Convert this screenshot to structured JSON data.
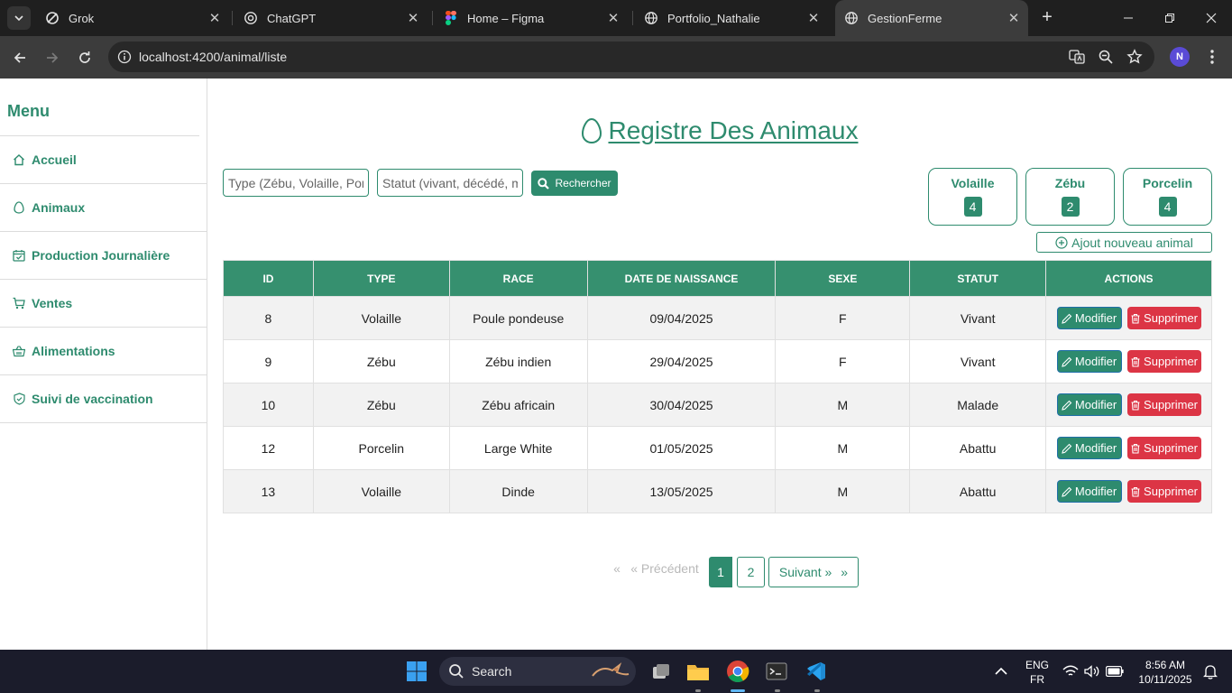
{
  "browser": {
    "tabs": [
      {
        "title": "Grok",
        "icon": "grok-icon",
        "active": false
      },
      {
        "title": "ChatGPT",
        "icon": "chatgpt-icon",
        "active": false
      },
      {
        "title": "Home – Figma",
        "icon": "figma-icon",
        "active": false
      },
      {
        "title": "Portfolio_Nathalie",
        "icon": "globe-icon",
        "active": false
      },
      {
        "title": "GestionFerme",
        "icon": "globe-icon",
        "active": true
      }
    ],
    "url": "localhost:4200/animal/liste",
    "profile_initial": "N"
  },
  "sidebar": {
    "title": "Menu",
    "items": [
      {
        "label": "Accueil",
        "icon": "home-icon"
      },
      {
        "label": "Animaux",
        "icon": "egg-icon"
      },
      {
        "label": "Production Journalière",
        "icon": "calendar-check-icon"
      },
      {
        "label": "Ventes",
        "icon": "cart-icon"
      },
      {
        "label": "Alimentations",
        "icon": "basket-icon"
      },
      {
        "label": "Suivi de vaccination",
        "icon": "shield-check-icon"
      }
    ]
  },
  "main": {
    "title": "Registre Des Animaux",
    "search": {
      "type_placeholder": "Type (Zébu, Volaille, Porcelin)",
      "status_placeholder": "Statut (vivant, décédé, malade)",
      "button_label": "Rechercher"
    },
    "stats": [
      {
        "label": "Volaille",
        "count": "4"
      },
      {
        "label": "Zébu",
        "count": "2"
      },
      {
        "label": "Porcelin",
        "count": "4"
      }
    ],
    "add_button": "Ajout nouveau animal",
    "table": {
      "columns": [
        "ID",
        "Type",
        "Race",
        "Date de naissance",
        "Sexe",
        "Statut",
        "Actions"
      ],
      "rows": [
        {
          "id": "8",
          "type": "Volaille",
          "race": "Poule pondeuse",
          "date": "09/04/2025",
          "sexe": "F",
          "statut": "Vivant"
        },
        {
          "id": "9",
          "type": "Zébu",
          "race": "Zébu indien",
          "date": "29/04/2025",
          "sexe": "F",
          "statut": "Vivant"
        },
        {
          "id": "10",
          "type": "Zébu",
          "race": "Zébu africain",
          "date": "30/04/2025",
          "sexe": "M",
          "statut": "Malade"
        },
        {
          "id": "12",
          "type": "Porcelin",
          "race": "Large White",
          "date": "01/05/2025",
          "sexe": "M",
          "statut": "Abattu"
        },
        {
          "id": "13",
          "type": "Volaille",
          "race": "Dinde",
          "date": "13/05/2025",
          "sexe": "M",
          "statut": "Abattu"
        }
      ],
      "edit_label": "Modifier",
      "delete_label": "Supprimer"
    },
    "pagination": {
      "first": "«",
      "prev": "« Précédent",
      "pages": [
        "1",
        "2"
      ],
      "current": "1",
      "next": "Suivant »",
      "last": "»"
    }
  },
  "taskbar": {
    "search_label": "Search",
    "language": "ENG",
    "region": "FR",
    "time": "8:56 AM",
    "date": "10/11/2025"
  },
  "colors": {
    "brand_green": "#2e8b6e",
    "header_green": "#36906f",
    "danger": "#dc3545",
    "chrome_dark": "#1f1f1f"
  }
}
